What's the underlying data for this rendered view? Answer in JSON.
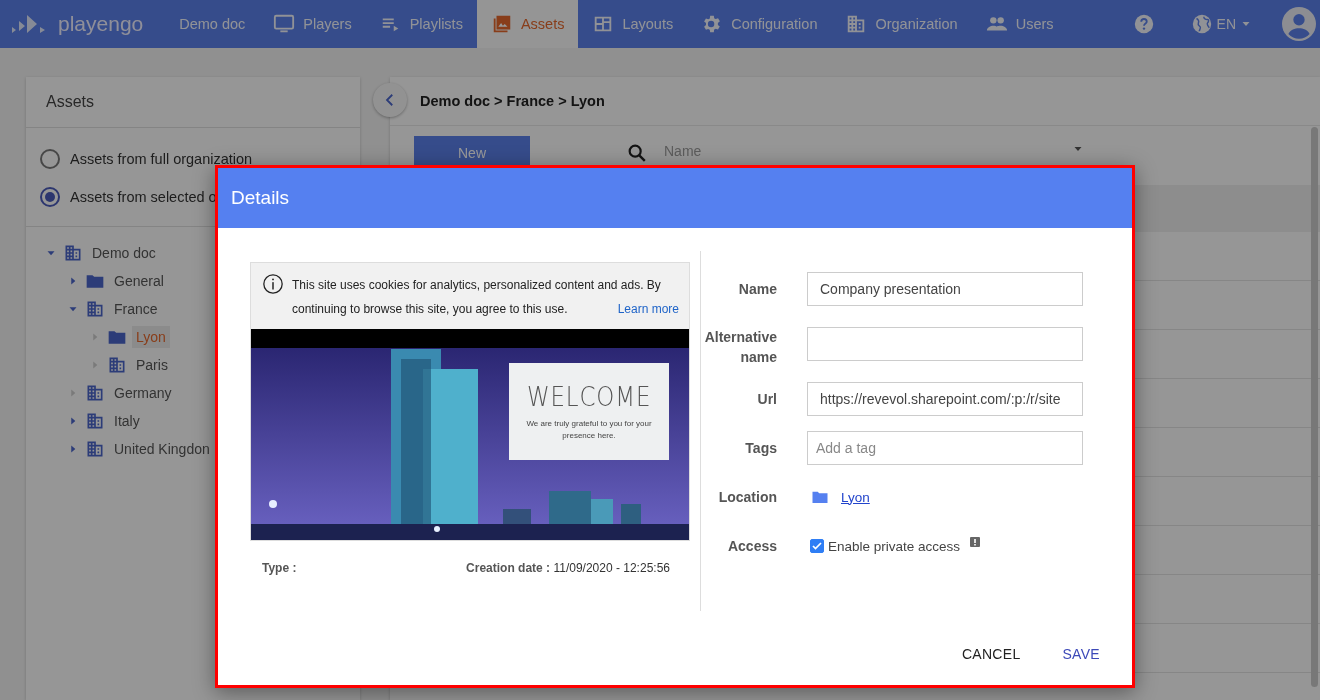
{
  "nav": {
    "logo": "playengo",
    "items": [
      {
        "label": "Demo doc",
        "selected": false
      },
      {
        "label": "Players",
        "selected": false
      },
      {
        "label": "Playlists",
        "selected": false
      },
      {
        "label": "Assets",
        "selected": true
      },
      {
        "label": "Layouts",
        "selected": false
      },
      {
        "label": "Configuration",
        "selected": false
      },
      {
        "label": "Organization",
        "selected": false
      },
      {
        "label": "Users",
        "selected": false
      }
    ],
    "language": "EN"
  },
  "sidebar": {
    "title": "Assets",
    "scopes": [
      {
        "label": "Assets from full organization",
        "selected": false
      },
      {
        "label": "Assets from selected o",
        "selected": true
      }
    ],
    "tree": [
      {
        "label": "Demo doc",
        "kind": "building",
        "expandable": true,
        "expanded": true,
        "selected": false,
        "children": [
          {
            "label": "General",
            "kind": "folder",
            "expandable": true,
            "expanded": false,
            "selected": false
          },
          {
            "label": "France",
            "kind": "building",
            "expandable": true,
            "expanded": true,
            "selected": false,
            "children": [
              {
                "label": "Lyon",
                "kind": "folder",
                "expandable": false,
                "expanded": false,
                "selected": true
              },
              {
                "label": "Paris",
                "kind": "building",
                "expandable": false,
                "expanded": false,
                "selected": false
              }
            ]
          },
          {
            "label": "Germany",
            "kind": "building",
            "expandable": false,
            "expanded": false,
            "selected": false
          },
          {
            "label": "Italy",
            "kind": "building",
            "expandable": true,
            "expanded": false,
            "selected": false
          },
          {
            "label": "United Kingdon",
            "kind": "building",
            "expandable": true,
            "expanded": false,
            "selected": false
          }
        ]
      }
    ]
  },
  "main": {
    "breadcrumb": "Demo doc > France > Lyon",
    "new_button": "New",
    "search_placeholder": "Name"
  },
  "dialog": {
    "title": "Details",
    "preview": {
      "kind": "picture",
      "cookie_text": "This site uses cookies for analytics, personalized content and ads. By continuing to browse this site, you agree to this use.",
      "learn_more": "Learn more",
      "welcome_title": "WELCOME",
      "welcome_text": "We are truly grateful to you for your presence here."
    },
    "type_label": "Type :",
    "creation_date": "**Creation date :** 11/09/2020 - 12:25:56",
    "fields": [
      {
        "label": "Name",
        "kind": "text",
        "value": "Company presentation"
      },
      {
        "label": "Alternative name",
        "kind": "text"
      },
      {
        "label": "Url",
        "kind": "text",
        "value": "https://revevol.sharepoint.com/:p:/r/site"
      },
      {
        "label": "Tags",
        "kind": "tags",
        "placeholder": "Add a tag"
      },
      {
        "label": "Location",
        "kind": "link",
        "value": "Lyon"
      },
      {
        "label": "Access",
        "kind": "checkbox",
        "value": "Enable private access",
        "checked": true
      }
    ],
    "buttons": [
      {
        "label": "CANCEL",
        "kind": "plain"
      },
      {
        "label": "SAVE",
        "kind": "primary"
      }
    ]
  }
}
